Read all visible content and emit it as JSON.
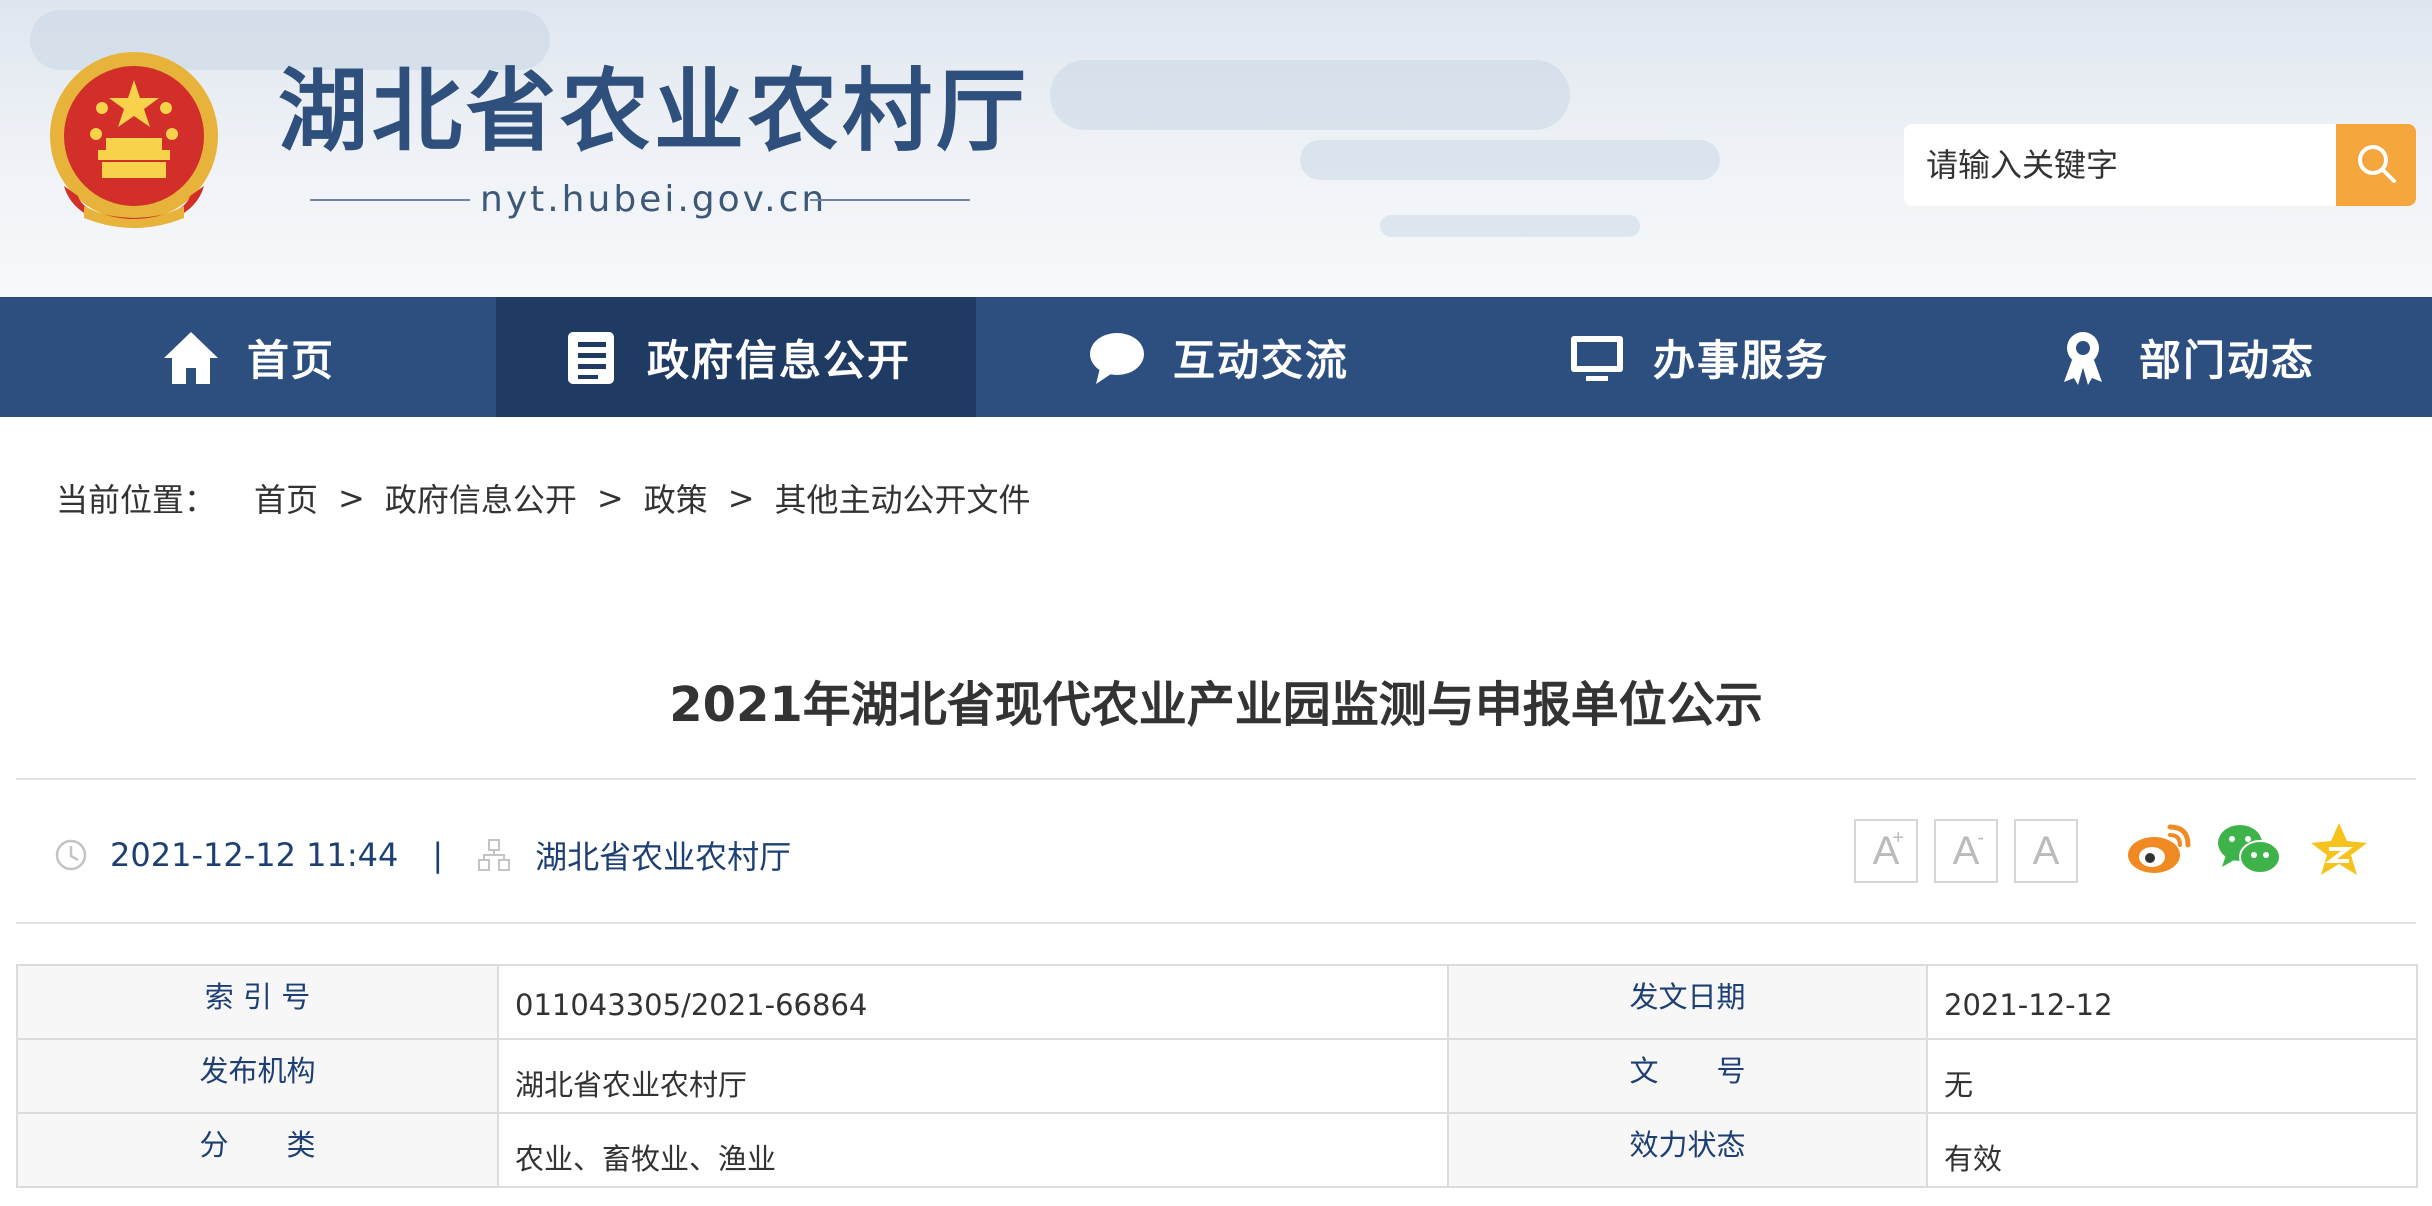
{
  "header": {
    "site_title": "湖北省农业农村厅",
    "domain": "nyt.hubei.gov.cn",
    "emblem_icon": "national-emblem-icon",
    "search": {
      "placeholder": "请输入关键字",
      "button_icon": "search-icon"
    }
  },
  "nav": {
    "items": [
      {
        "label": "首页",
        "icon": "home-icon",
        "active": false
      },
      {
        "label": "政府信息公开",
        "icon": "document-list-icon",
        "active": true
      },
      {
        "label": "互动交流",
        "icon": "chat-bubble-icon",
        "active": false
      },
      {
        "label": "办事服务",
        "icon": "monitor-icon",
        "active": false
      },
      {
        "label": "部门动态",
        "icon": "ribbon-badge-icon",
        "active": false
      }
    ]
  },
  "breadcrumb": {
    "prefix": "当前位置：",
    "items": [
      "首页",
      "政府信息公开",
      "政策",
      "其他主动公开文件"
    ],
    "separator": ">"
  },
  "article": {
    "title": "2021年湖北省现代农业产业园监测与申报单位公示",
    "datetime": "2021-12-12 11:44",
    "divider": "|",
    "source": "湖北省农业农村厅"
  },
  "tools": {
    "font_buttons": [
      {
        "label": "A",
        "sup": "+"
      },
      {
        "label": "A",
        "sup": "-"
      },
      {
        "label": "A",
        "sup": ""
      }
    ],
    "share": [
      {
        "icon": "weibo-icon",
        "color": "#f08a22"
      },
      {
        "icon": "wechat-icon",
        "color": "#3db34a"
      },
      {
        "icon": "qzone-icon",
        "color": "#f6c21c"
      }
    ]
  },
  "info_table": {
    "rows": [
      {
        "k1": "索 引 号",
        "v1": "011043305/2021-66864",
        "k2": "发文日期",
        "v2": "2021-12-12"
      },
      {
        "k1": "发布机构",
        "v1": "湖北省农业农村厅",
        "k2": "文　　号",
        "v2": "无"
      },
      {
        "k1": "分　　类",
        "v1": "农业、畜牧业、渔业",
        "k2": "效力状态",
        "v2": "有效"
      }
    ]
  },
  "colors": {
    "nav_bg": "#2d4f80",
    "nav_active_bg": "#1f3a63",
    "title_blue": "#2f4f7c",
    "search_orange": "#f5a63c",
    "meta_blue": "#1e3f73"
  }
}
